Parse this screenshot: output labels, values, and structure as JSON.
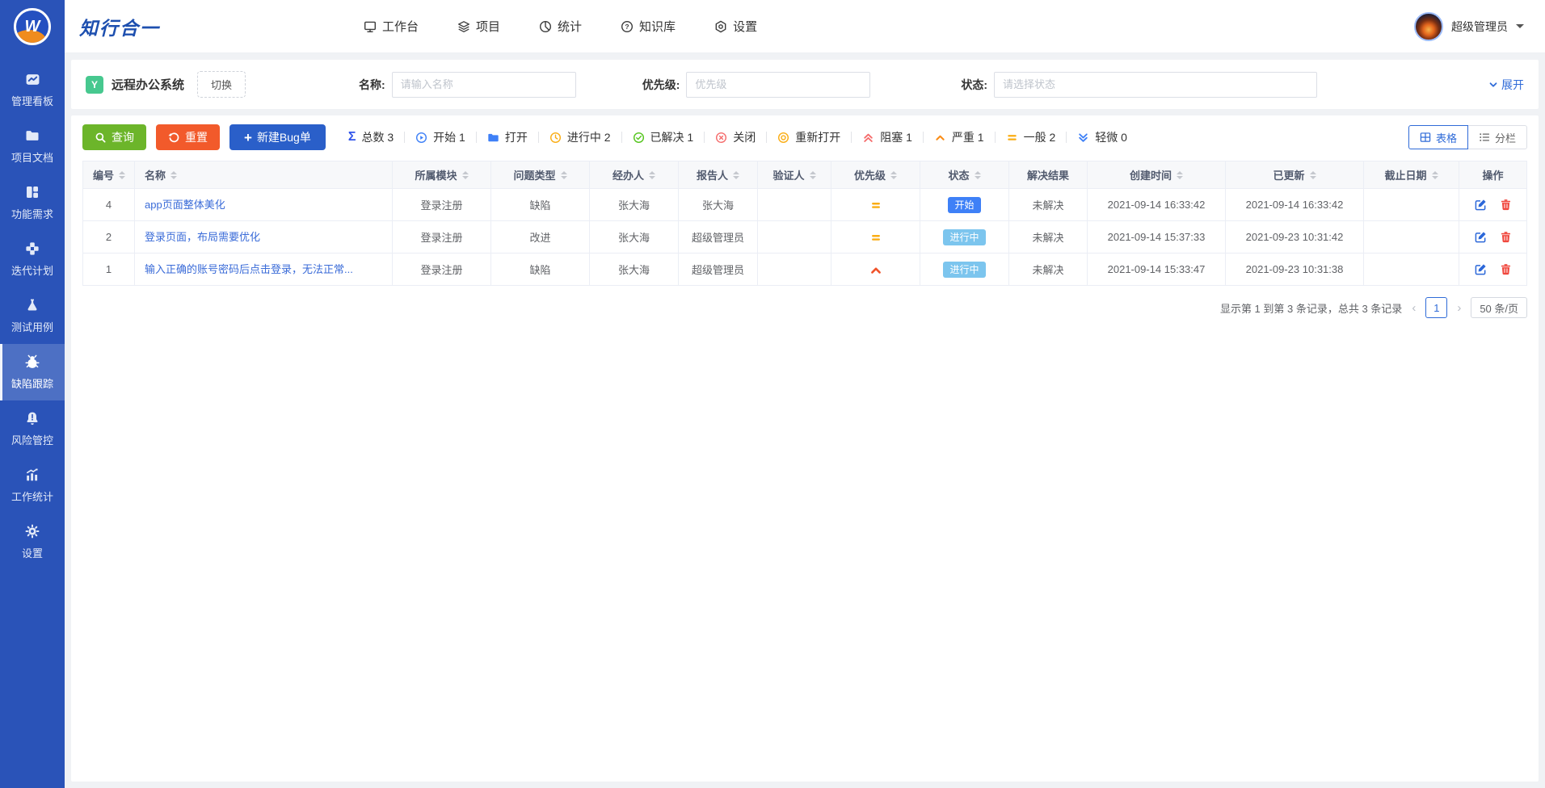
{
  "brand": {
    "name": "知行合一",
    "logo_letter": "W"
  },
  "topnav": {
    "items": [
      {
        "label": "工作台"
      },
      {
        "label": "项目"
      },
      {
        "label": "统计"
      },
      {
        "label": "知识库"
      },
      {
        "label": "设置"
      }
    ]
  },
  "user": {
    "name": "超级管理员"
  },
  "sidebar": {
    "items": [
      {
        "label": "管理看板"
      },
      {
        "label": "项目文档"
      },
      {
        "label": "功能需求"
      },
      {
        "label": "迭代计划"
      },
      {
        "label": "测试用例"
      },
      {
        "label": "缺陷跟踪",
        "active": true
      },
      {
        "label": "风险管控"
      },
      {
        "label": "工作统计"
      },
      {
        "label": "设置"
      }
    ]
  },
  "filter": {
    "project_badge": "Y",
    "project_name": "远程办公系统",
    "switch_label": "切换",
    "name_label": "名称:",
    "name_placeholder": "请输入名称",
    "priority_label": "优先级:",
    "priority_placeholder": "优先级",
    "status_label": "状态:",
    "status_placeholder": "请选择状态",
    "expand_label": "展开"
  },
  "toolbar": {
    "search_button": "查询",
    "reset_button": "重置",
    "create_button": "新建Bug单",
    "stats": [
      {
        "name": "total",
        "label": "总数 3"
      },
      {
        "name": "start",
        "label": "开始 1"
      },
      {
        "name": "open",
        "label": "打开"
      },
      {
        "name": "doing",
        "label": "进行中 2"
      },
      {
        "name": "resolved",
        "label": "已解决 1"
      },
      {
        "name": "closed",
        "label": "关闭"
      },
      {
        "name": "reopened",
        "label": "重新打开"
      },
      {
        "name": "blocked",
        "label": "阻塞 1"
      },
      {
        "name": "severe",
        "label": "严重 1"
      },
      {
        "name": "normal",
        "label": "一般 2"
      },
      {
        "name": "minor",
        "label": "轻微 0"
      }
    ],
    "view_table": "表格",
    "view_columns": "分栏"
  },
  "table": {
    "columns": [
      {
        "label": "编号"
      },
      {
        "label": "名称"
      },
      {
        "label": "所属模块"
      },
      {
        "label": "问题类型"
      },
      {
        "label": "经办人"
      },
      {
        "label": "报告人"
      },
      {
        "label": "验证人"
      },
      {
        "label": "优先级"
      },
      {
        "label": "状态"
      },
      {
        "label": "解决结果"
      },
      {
        "label": "创建时间"
      },
      {
        "label": "已更新"
      },
      {
        "label": "截止日期"
      },
      {
        "label": "操作"
      }
    ],
    "rows": [
      {
        "id": "4",
        "name": "app页面整体美化",
        "module": "登录注册",
        "type": "缺陷",
        "assignee": "张大海",
        "reporter": "张大海",
        "verifier": "",
        "priority": "normal",
        "status": "开始",
        "resolution": "未解决",
        "created": "2021-09-14 16:33:42",
        "updated": "2021-09-14 16:33:42",
        "due": ""
      },
      {
        "id": "2",
        "name": "登录页面，布局需要优化",
        "module": "登录注册",
        "type": "改进",
        "assignee": "张大海",
        "reporter": "超级管理员",
        "verifier": "",
        "priority": "normal",
        "status": "进行中",
        "resolution": "未解决",
        "created": "2021-09-14 15:37:33",
        "updated": "2021-09-23 10:31:42",
        "due": ""
      },
      {
        "id": "1",
        "name": "输入正确的账号密码后点击登录，无法正常...",
        "module": "登录注册",
        "type": "缺陷",
        "assignee": "张大海",
        "reporter": "超级管理员",
        "verifier": "",
        "priority": "severe",
        "status": "进行中",
        "resolution": "未解决",
        "created": "2021-09-14 15:33:47",
        "updated": "2021-09-23 10:31:38",
        "due": ""
      }
    ]
  },
  "pagination": {
    "summary": "显示第 1 到第 3 条记录，总共 3 条记录",
    "page": "1",
    "page_size": "50 条/页"
  },
  "colors": {
    "sidebar": "#2A53B8",
    "brand": "#1D4FAF",
    "primary": "#2F6BD8",
    "link": "#3A6BD8",
    "green_button": "#6CB52A",
    "orange_button": "#F25A2B",
    "blue_button": "#2A5FC9",
    "badge_start": "#3E80F7",
    "badge_doing": "#7CC5EE",
    "priority_normal": "#FAAD14",
    "priority_severe": "#F0532A",
    "project_badge": "#47C88F"
  }
}
